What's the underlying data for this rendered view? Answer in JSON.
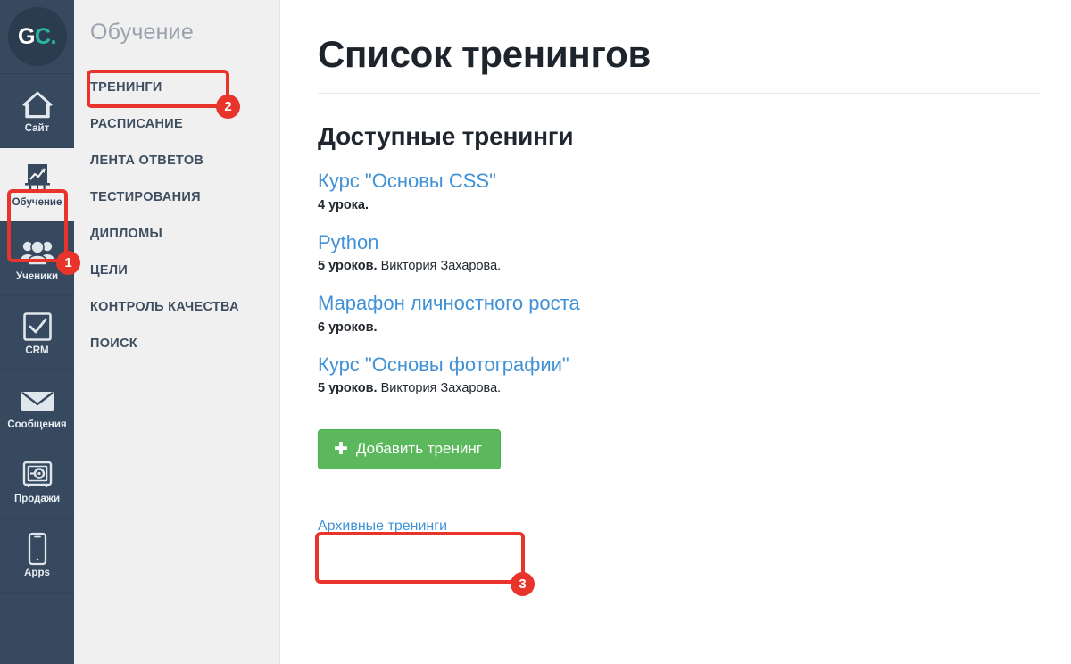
{
  "logo": {
    "part1": "G",
    "part2": "C."
  },
  "rail": {
    "items": [
      {
        "label": "Сайт",
        "icon": "house-icon",
        "active": false
      },
      {
        "label": "Обучение",
        "icon": "chart-easel-icon",
        "active": true
      },
      {
        "label": "Ученики",
        "icon": "people-icon",
        "active": false
      },
      {
        "label": "CRM",
        "icon": "checkbox-icon",
        "active": false
      },
      {
        "label": "Сообщения",
        "icon": "envelope-icon",
        "active": false
      },
      {
        "label": "Продажи",
        "icon": "safe-icon",
        "active": false
      },
      {
        "label": "Apps",
        "icon": "phone-icon",
        "active": false
      }
    ]
  },
  "menu": {
    "title": "Обучение",
    "items": [
      {
        "label": "ТРЕНИНГИ"
      },
      {
        "label": "РАСПИСАНИЕ"
      },
      {
        "label": "ЛЕНТА ОТВЕТОВ"
      },
      {
        "label": "ТЕСТИРОВАНИЯ"
      },
      {
        "label": "ДИПЛОМЫ"
      },
      {
        "label": "ЦЕЛИ"
      },
      {
        "label": "КОНТРОЛЬ КАЧЕСТВА"
      },
      {
        "label": "ПОИСК"
      }
    ]
  },
  "main": {
    "page_title": "Список тренингов",
    "section_title": "Доступные тренинги",
    "courses": [
      {
        "title": "Курс \"Основы CSS\"",
        "lessons": "4 урока.",
        "author": ""
      },
      {
        "title": "Python",
        "lessons": "5 уроков.",
        "author": " Виктория Захарова."
      },
      {
        "title": "Марафон личностного роста",
        "lessons": "6 уроков.",
        "author": ""
      },
      {
        "title": "Курс \"Основы фотографии\"",
        "lessons": "5 уроков.",
        "author": " Виктория Захарова."
      }
    ],
    "add_button": {
      "icon": "plus-icon",
      "label": "Добавить тренинг"
    },
    "archive_link": "Архивные тренинги"
  },
  "annotations": {
    "badges": [
      {
        "number": "1",
        "target": "rail-item-obuchenie"
      },
      {
        "number": "2",
        "target": "menu-item-treningi"
      },
      {
        "number": "3",
        "target": "add-training-button"
      }
    ]
  },
  "colors": {
    "rail_bg": "#37495e",
    "menu_bg": "#f0f0f0",
    "link": "#4091d6",
    "accent_green": "#5cb85c",
    "annotation_red": "#e8342a",
    "logo_teal": "#2ab5a0"
  }
}
